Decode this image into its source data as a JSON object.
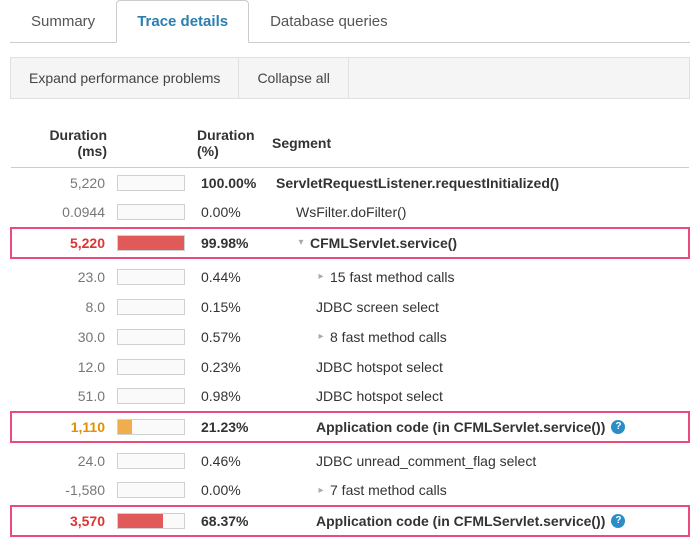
{
  "tabs": [
    {
      "label": "Summary",
      "active": false
    },
    {
      "label": "Trace details",
      "active": true
    },
    {
      "label": "Database queries",
      "active": false
    }
  ],
  "toolbar": {
    "expand": "Expand performance problems",
    "collapse": "Collapse all"
  },
  "columns": {
    "dur_ms": "Duration (ms)",
    "dur_pct": "Duration (%)",
    "segment": "Segment"
  },
  "colors": {
    "red": "#e05a5a",
    "orange": "#f0ad4e"
  },
  "rows": [
    {
      "ms": "5,220",
      "pct": "100.00%",
      "bar": 100,
      "barColor": "none",
      "seg": "ServletRequestListener.requestInitialized()",
      "indent": 0,
      "chev": "",
      "bold": true,
      "highlight": "",
      "help": false
    },
    {
      "ms": "0.0944",
      "pct": "0.00%",
      "bar": 0,
      "barColor": "none",
      "seg": "WsFilter.doFilter()",
      "indent": 1,
      "chev": "",
      "bold": false,
      "highlight": "",
      "help": false
    },
    {
      "ms": "5,220",
      "pct": "99.98%",
      "bar": 100,
      "barColor": "red",
      "seg": "CFMLServlet.service()",
      "indent": 1,
      "chev": "down",
      "bold": true,
      "highlight": "red",
      "msColor": "#d33",
      "help": false
    },
    {
      "ms": "23.0",
      "pct": "0.44%",
      "bar": 0.4,
      "barColor": "none",
      "seg": "15 fast method calls",
      "indent": 2,
      "chev": "right",
      "bold": false,
      "highlight": "",
      "help": false
    },
    {
      "ms": "8.0",
      "pct": "0.15%",
      "bar": 0.2,
      "barColor": "none",
      "seg": "JDBC screen select",
      "indent": 2,
      "chev": "",
      "bold": false,
      "highlight": "",
      "help": false
    },
    {
      "ms": "30.0",
      "pct": "0.57%",
      "bar": 0.6,
      "barColor": "none",
      "seg": "8 fast method calls",
      "indent": 2,
      "chev": "right",
      "bold": false,
      "highlight": "",
      "help": false
    },
    {
      "ms": "12.0",
      "pct": "0.23%",
      "bar": 0.2,
      "barColor": "none",
      "seg": "JDBC hotspot select",
      "indent": 2,
      "chev": "",
      "bold": false,
      "highlight": "",
      "help": false
    },
    {
      "ms": "51.0",
      "pct": "0.98%",
      "bar": 1,
      "barColor": "none",
      "seg": "JDBC hotspot select",
      "indent": 2,
      "chev": "",
      "bold": false,
      "highlight": "",
      "help": false
    },
    {
      "ms": "1,110",
      "pct": "21.23%",
      "bar": 21,
      "barColor": "orange",
      "seg": "Application code (in CFMLServlet.service())",
      "indent": 2,
      "chev": "",
      "bold": true,
      "highlight": "orange",
      "msColor": "#e09000",
      "help": true
    },
    {
      "ms": "24.0",
      "pct": "0.46%",
      "bar": 0.5,
      "barColor": "none",
      "seg": "JDBC unread_comment_flag select",
      "indent": 2,
      "chev": "",
      "bold": false,
      "highlight": "",
      "help": false
    },
    {
      "ms": "-1,580",
      "pct": "0.00%",
      "bar": 0,
      "barColor": "none",
      "seg": "7 fast method calls",
      "indent": 2,
      "chev": "right",
      "bold": false,
      "highlight": "",
      "help": false
    },
    {
      "ms": "3,570",
      "pct": "68.37%",
      "bar": 68,
      "barColor": "red",
      "seg": "Application code (in CFMLServlet.service())",
      "indent": 2,
      "chev": "",
      "bold": true,
      "highlight": "red",
      "msColor": "#d33",
      "help": true
    }
  ]
}
